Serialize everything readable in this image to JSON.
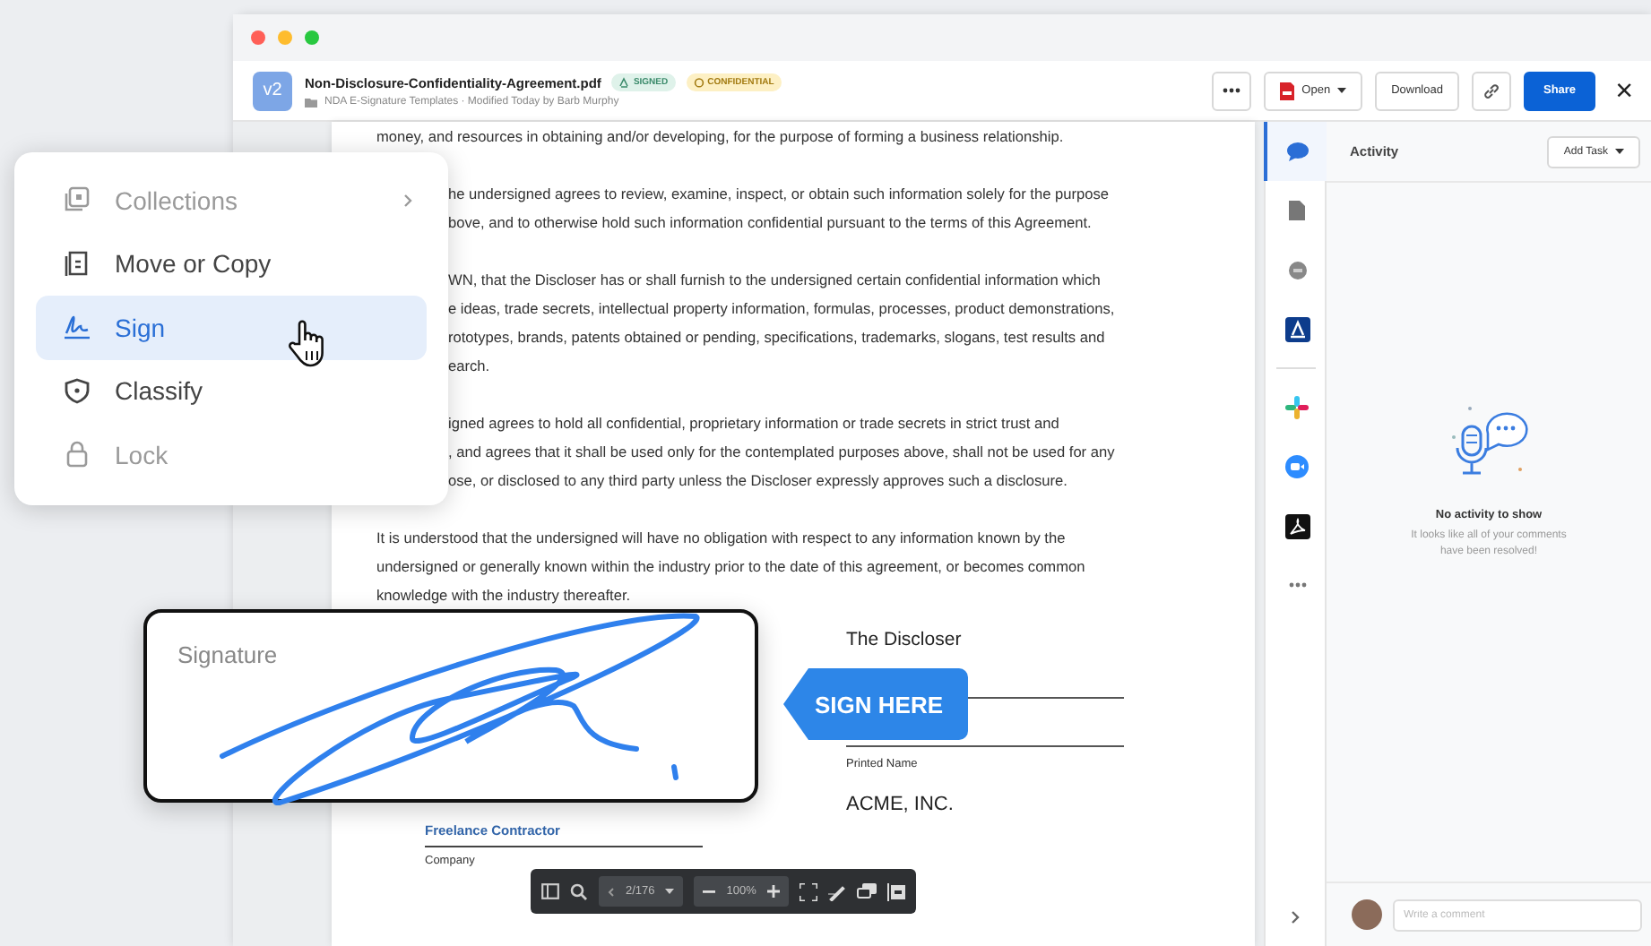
{
  "window": {
    "traffic_lights": [
      {
        "color": "#ff5f57"
      },
      {
        "color": "#febc2e"
      },
      {
        "color": "#28c840"
      }
    ]
  },
  "file_header": {
    "version": "v2",
    "title": "Non-Disclosure-Confidentiality-Agreement.pdf",
    "badges": [
      {
        "kind": "signed",
        "label": "SIGNED"
      },
      {
        "kind": "confidential",
        "label": "CONFIDENTIAL"
      }
    ],
    "subtitle": "NDA E-Signature Templates · Modified Today by Barb Murphy",
    "actions": [
      {
        "kind": "more"
      },
      {
        "kind": "open",
        "label": "Open"
      },
      {
        "kind": "plain",
        "label": "Download"
      },
      {
        "kind": "link"
      },
      {
        "kind": "primary",
        "label": "Share"
      },
      {
        "kind": "close",
        "label": "×"
      }
    ]
  },
  "document": {
    "paragraphs": [
      {
        "lines": [
          {
            "text": "money, and resources in obtaining and/or developing, for the purpose of forming a business relationship."
          }
        ]
      },
      {
        "lines": [
          {
            "text": "he undersigned agrees to review, examine, inspect, or obtain such information solely for the purpose",
            "partial": true
          },
          {
            "text": "bove, and to otherwise hold such information confidential pursuant to the terms of this Agreement.",
            "partial": true
          }
        ]
      },
      {
        "lines": [
          {
            "text": "WN, that the Discloser has or shall furnish to the undersigned certain confidential information which",
            "partial": true
          },
          {
            "text": "e ideas, trade secrets, intellectual property information, formulas, processes, product demonstrations,",
            "partial": true
          },
          {
            "text": "rototypes, brands, patents obtained or pending, specifications, trademarks, slogans, test results and",
            "partial": true
          },
          {
            "text": "earch.",
            "partial": true
          }
        ]
      },
      {
        "lines": [
          {
            "text": "igned agrees to hold all confidential, proprietary information or trade secrets in strict trust and",
            "partial": true
          },
          {
            "text": ", and agrees that it shall be used only for the contemplated purposes above, shall not be used for any",
            "partial": true
          },
          {
            "text": "ose, or disclosed to any third party unless the Discloser expressly approves such a disclosure.",
            "partial": true
          }
        ]
      },
      {
        "lines": [
          {
            "text": "It is understood that the undersigned will have no obligation with respect to any information known by the"
          },
          {
            "text": "undersigned or generally known within the industry prior to the date of this agreement, or becomes common"
          },
          {
            "text": "knowledge with the industry thereafter."
          }
        ]
      }
    ],
    "signature_block": {
      "left": {
        "name": "Freelance Contractor",
        "caption": "Company"
      },
      "right": {
        "title": "The Discloser",
        "caption": "Printed Name",
        "name": "ACME, INC."
      }
    }
  },
  "context_menu": {
    "items": [
      {
        "kind": "collections",
        "label": "Collections",
        "disabled": true,
        "submenu": true,
        "selected": false
      },
      {
        "kind": "move",
        "label": "Move or Copy",
        "disabled": false,
        "submenu": false,
        "selected": false
      },
      {
        "kind": "sign",
        "label": "Sign",
        "disabled": false,
        "submenu": false,
        "selected": true
      },
      {
        "kind": "classify",
        "label": "Classify",
        "disabled": false,
        "submenu": false,
        "selected": false
      },
      {
        "kind": "lock",
        "label": "Lock",
        "disabled": true,
        "submenu": false,
        "selected": false
      }
    ]
  },
  "signature_card": {
    "label": "Signature"
  },
  "sign_here": {
    "label": "SIGN HERE"
  },
  "viewer_toolbar": {
    "page": "2/176",
    "zoom": "100%"
  },
  "side_rail": {
    "items": [
      {
        "kind": "comments",
        "selected": true
      },
      {
        "kind": "details",
        "selected": false
      },
      {
        "kind": "circle",
        "selected": false
      },
      {
        "kind": "sign-app",
        "selected": false
      },
      {
        "kind": "divider"
      },
      {
        "kind": "grid-app",
        "selected": false
      },
      {
        "kind": "video-app",
        "selected": false
      },
      {
        "kind": "pdf-app",
        "selected": false
      },
      {
        "kind": "more",
        "selected": false
      }
    ]
  },
  "activity": {
    "title": "Activity",
    "add_task": "Add Task",
    "empty_title": "No activity to show",
    "empty_text": "It looks like all of your comments have been resolved!",
    "comment_placeholder": "Write a comment"
  }
}
